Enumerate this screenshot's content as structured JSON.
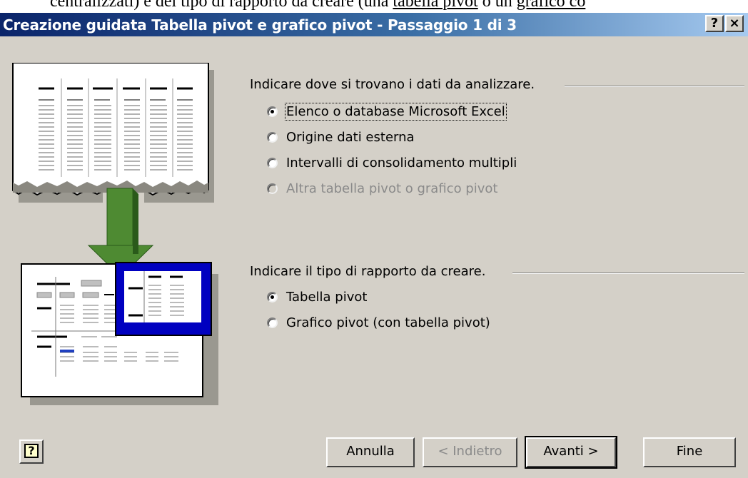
{
  "background_text": {
    "prefix": "centralizzati) e del tipo di rapporto da creare (una ",
    "link1": "tabella pivot",
    "middle": " o un ",
    "link2": "grafico co"
  },
  "window": {
    "title": "Creazione guidata Tabella pivot e grafico pivot - Passaggio 1 di 3",
    "help_button": "?",
    "close_button": "×"
  },
  "data_source": {
    "heading": "Indicare dove si trovano i dati da analizzare.",
    "options": [
      {
        "label": "Elenco o database Microsoft Excel",
        "selected": true,
        "enabled": true
      },
      {
        "label": "Origine dati esterna",
        "selected": false,
        "enabled": true
      },
      {
        "label": "Intervalli di consolidamento multipli",
        "selected": false,
        "enabled": true
      },
      {
        "label": "Altra tabella pivot o grafico pivot",
        "selected": false,
        "enabled": false
      }
    ]
  },
  "report_type": {
    "heading": "Indicare il tipo di rapporto da creare.",
    "options": [
      {
        "label": "Tabella pivot",
        "selected": true,
        "enabled": true
      },
      {
        "label": "Grafico pivot (con tabella pivot)",
        "selected": false,
        "enabled": true
      }
    ]
  },
  "buttons": {
    "cancel": "Annulla",
    "back": "< Indietro",
    "next": "Avanti >",
    "finish": "Fine"
  },
  "colors": {
    "titlebar_start": "#0a246a",
    "titlebar_end": "#a6caf0",
    "face": "#d4d0c8",
    "arrow_green": "#4e8a32",
    "pivot_blue": "#0000c0"
  },
  "icons": {
    "help": "help-icon",
    "wizard_illustration": "pivot-wizard-illustration"
  }
}
